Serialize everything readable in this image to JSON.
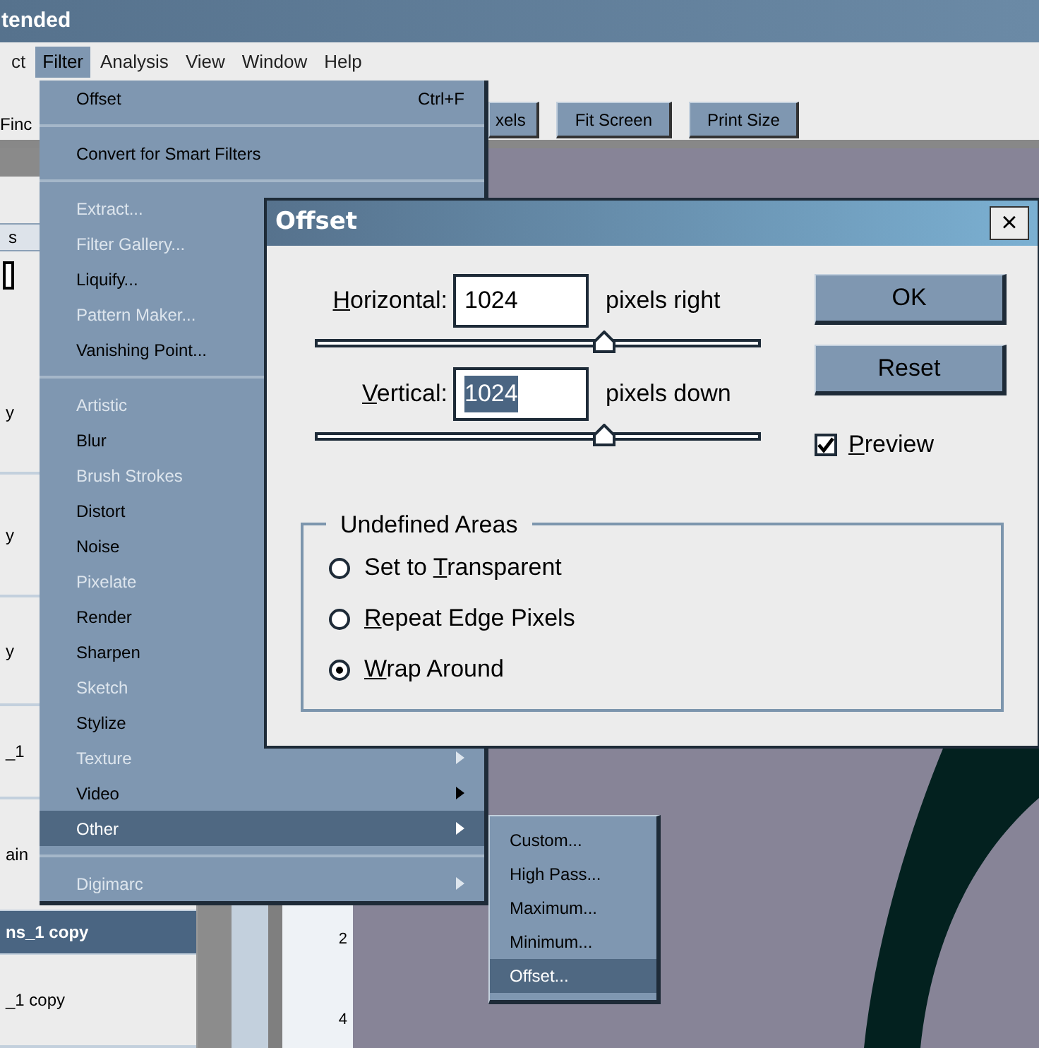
{
  "app": {
    "title": "tended",
    "menus": [
      {
        "label": "ct",
        "selected": false
      },
      {
        "label": "Filter",
        "selected": true
      },
      {
        "label": "Analysis",
        "selected": false
      },
      {
        "label": "View",
        "selected": false
      },
      {
        "label": "Window",
        "selected": false
      },
      {
        "label": "Help",
        "selected": false
      }
    ]
  },
  "options_bar": {
    "label": "Finc",
    "buttons": [
      "xels",
      "Fit Screen",
      "Print Size"
    ]
  },
  "left_panel": {
    "tab": "s",
    "rows": [
      {
        "label": "y",
        "selected": false
      },
      {
        "label": "y",
        "selected": false
      },
      {
        "label": "y",
        "selected": false
      },
      {
        "label": "_1",
        "selected": false
      },
      {
        "label": "ain",
        "selected": false
      },
      {
        "label": "ns_1 copy",
        "selected": true
      },
      {
        "label": "_1 copy",
        "selected": false
      }
    ]
  },
  "ruler": {
    "labels": [
      "2",
      "4"
    ]
  },
  "filter_menu": {
    "items": [
      {
        "kind": "item",
        "label": "Offset",
        "shortcut": "Ctrl+F",
        "disabled": false,
        "submenu": false,
        "selected": false
      },
      {
        "kind": "separator"
      },
      {
        "kind": "item",
        "label": "Convert for Smart Filters",
        "disabled": false,
        "submenu": false,
        "selected": false
      },
      {
        "kind": "separator"
      },
      {
        "kind": "item",
        "label": "Extract...",
        "disabled": true,
        "selected": false
      },
      {
        "kind": "item",
        "label": "Filter Gallery...",
        "disabled": true,
        "selected": false
      },
      {
        "kind": "item",
        "label": "Liquify...",
        "disabled": false,
        "selected": false
      },
      {
        "kind": "item",
        "label": "Pattern Maker...",
        "disabled": true,
        "selected": false
      },
      {
        "kind": "item",
        "label": "Vanishing Point...",
        "disabled": false,
        "selected": false
      },
      {
        "kind": "separator"
      },
      {
        "kind": "item",
        "label": "Artistic",
        "disabled": true,
        "selected": false
      },
      {
        "kind": "item",
        "label": "Blur",
        "disabled": false,
        "selected": false
      },
      {
        "kind": "item",
        "label": "Brush Strokes",
        "disabled": true,
        "selected": false
      },
      {
        "kind": "item",
        "label": "Distort",
        "disabled": false,
        "selected": false
      },
      {
        "kind": "item",
        "label": "Noise",
        "disabled": false,
        "selected": false
      },
      {
        "kind": "item",
        "label": "Pixelate",
        "disabled": true,
        "selected": false
      },
      {
        "kind": "item",
        "label": "Render",
        "disabled": false,
        "selected": false
      },
      {
        "kind": "item",
        "label": "Sharpen",
        "disabled": false,
        "selected": false
      },
      {
        "kind": "item",
        "label": "Sketch",
        "disabled": true,
        "selected": false
      },
      {
        "kind": "item",
        "label": "Stylize",
        "disabled": false,
        "selected": false
      },
      {
        "kind": "item",
        "label": "Texture",
        "disabled": true,
        "submenu": true,
        "selected": false
      },
      {
        "kind": "item",
        "label": "Video",
        "disabled": false,
        "submenu": true,
        "selected": false
      },
      {
        "kind": "item",
        "label": "Other",
        "disabled": false,
        "submenu": true,
        "selected": true
      },
      {
        "kind": "separator"
      },
      {
        "kind": "item",
        "label": "Digimarc",
        "disabled": true,
        "submenu": true,
        "selected": false
      }
    ]
  },
  "other_submenu": {
    "items": [
      {
        "label": "Custom...",
        "selected": false
      },
      {
        "label": "High Pass...",
        "selected": false
      },
      {
        "label": "Maximum...",
        "selected": false
      },
      {
        "label": "Minimum...",
        "selected": false
      },
      {
        "label": "Offset...",
        "selected": true
      }
    ]
  },
  "dialog": {
    "title": "Offset",
    "close": "×",
    "fields": [
      {
        "label": {
          "key": "H",
          "post": "orizontal:"
        },
        "value": "1024",
        "value_selected": false,
        "unit": "pixels right",
        "level": 0.65
      },
      {
        "label": {
          "key": "V",
          "post": "ertical:"
        },
        "value": "1024",
        "value_selected": true,
        "unit": "pixels down",
        "level": 0.65
      }
    ],
    "buttons": [
      "OK",
      "Reset"
    ],
    "preview": {
      "label": {
        "key": "P",
        "post": "review"
      },
      "checked": true
    },
    "group": {
      "title": "Undefined Areas",
      "options": [
        {
          "label": {
            "pre": "Set to ",
            "key": "T",
            "post": "ransparent"
          },
          "selected": false
        },
        {
          "label": {
            "key": "R",
            "post": "epeat Edge Pixels"
          },
          "selected": false
        },
        {
          "label": {
            "key": "W",
            "post": "rap Around"
          },
          "selected": true
        }
      ]
    }
  }
}
